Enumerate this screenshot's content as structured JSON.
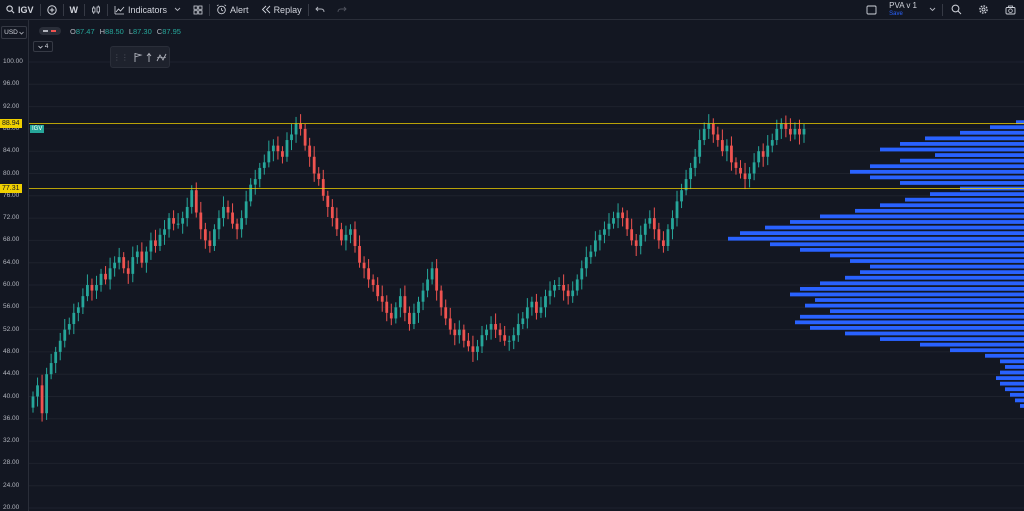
{
  "toolbar": {
    "symbol": "IGV",
    "interval": "W",
    "indicators_label": "Indicators",
    "alert_label": "Alert",
    "replay_label": "Replay",
    "layout_name": "PVA v 1",
    "layout_save": "Save"
  },
  "legend": {
    "open_key": "O",
    "open": "87.47",
    "high_key": "H",
    "high": "88.50",
    "low_key": "L",
    "low": "87.30",
    "close_key": "C",
    "close": "87.95"
  },
  "currency": "USD",
  "collapse_count": "4",
  "price_axis": {
    "min": 20,
    "max": 104,
    "ticks": [
      "100.00",
      "96.00",
      "92.00",
      "88.00",
      "84.00",
      "80.00",
      "76.00",
      "72.00",
      "68.00",
      "64.00",
      "60.00",
      "56.00",
      "52.00",
      "48.00",
      "44.00",
      "40.00",
      "36.00",
      "32.00",
      "28.00",
      "24.00",
      "20.00"
    ],
    "tick_values": [
      100,
      96,
      92,
      88,
      84,
      80,
      76,
      72,
      68,
      64,
      60,
      56,
      52,
      48,
      44,
      40,
      36,
      32,
      28,
      24,
      20
    ]
  },
  "levels": [
    {
      "label": "88.94",
      "value": 88.94,
      "color": "#f0d000"
    },
    {
      "label": "77.31",
      "value": 77.31,
      "color": "#f0d000"
    }
  ],
  "symbol_tag": "IGV",
  "colors": {
    "up": "#26a69a",
    "down": "#ef5350",
    "volume_profile": "#2962ff",
    "bg": "#131722",
    "grid": "#1e222d"
  },
  "chart_data": {
    "type": "candlestick",
    "ylim": [
      20,
      104
    ],
    "path": [
      40,
      42,
      37,
      44,
      46,
      48,
      50,
      52,
      53,
      55,
      56,
      58,
      60,
      59,
      60,
      62,
      61,
      63,
      64,
      65,
      63,
      62,
      65,
      66,
      64,
      66,
      68,
      67,
      69,
      70,
      72,
      71,
      71,
      72,
      74,
      77,
      73,
      70,
      68,
      67,
      70,
      72,
      74,
      73,
      71,
      70,
      72,
      75,
      78,
      79,
      81,
      82,
      84,
      85,
      84,
      83,
      86,
      87,
      89,
      88,
      85,
      83,
      80,
      79,
      76,
      74,
      72,
      70,
      68,
      69,
      70,
      67,
      64,
      63,
      61,
      60,
      58,
      57,
      55,
      54,
      56,
      58,
      55,
      53,
      55,
      57,
      59,
      61,
      63,
      59,
      56,
      54,
      52,
      51,
      52,
      50,
      49,
      48,
      49,
      51,
      52,
      53,
      52,
      51,
      50,
      50,
      51,
      53,
      54,
      56,
      57,
      55,
      56,
      58,
      59,
      60,
      60,
      59,
      58,
      59,
      61,
      63,
      65,
      66,
      68,
      69,
      70,
      71,
      72,
      73,
      72,
      70,
      68,
      67,
      69,
      71,
      72,
      70,
      68,
      67,
      70,
      72,
      75,
      77,
      79,
      81,
      83,
      86,
      88,
      89,
      87,
      86,
      84,
      85,
      82,
      81,
      80,
      79,
      80,
      82,
      84,
      83,
      85,
      86,
      88,
      89,
      88,
      87,
      88,
      87,
      88
    ]
  }
}
